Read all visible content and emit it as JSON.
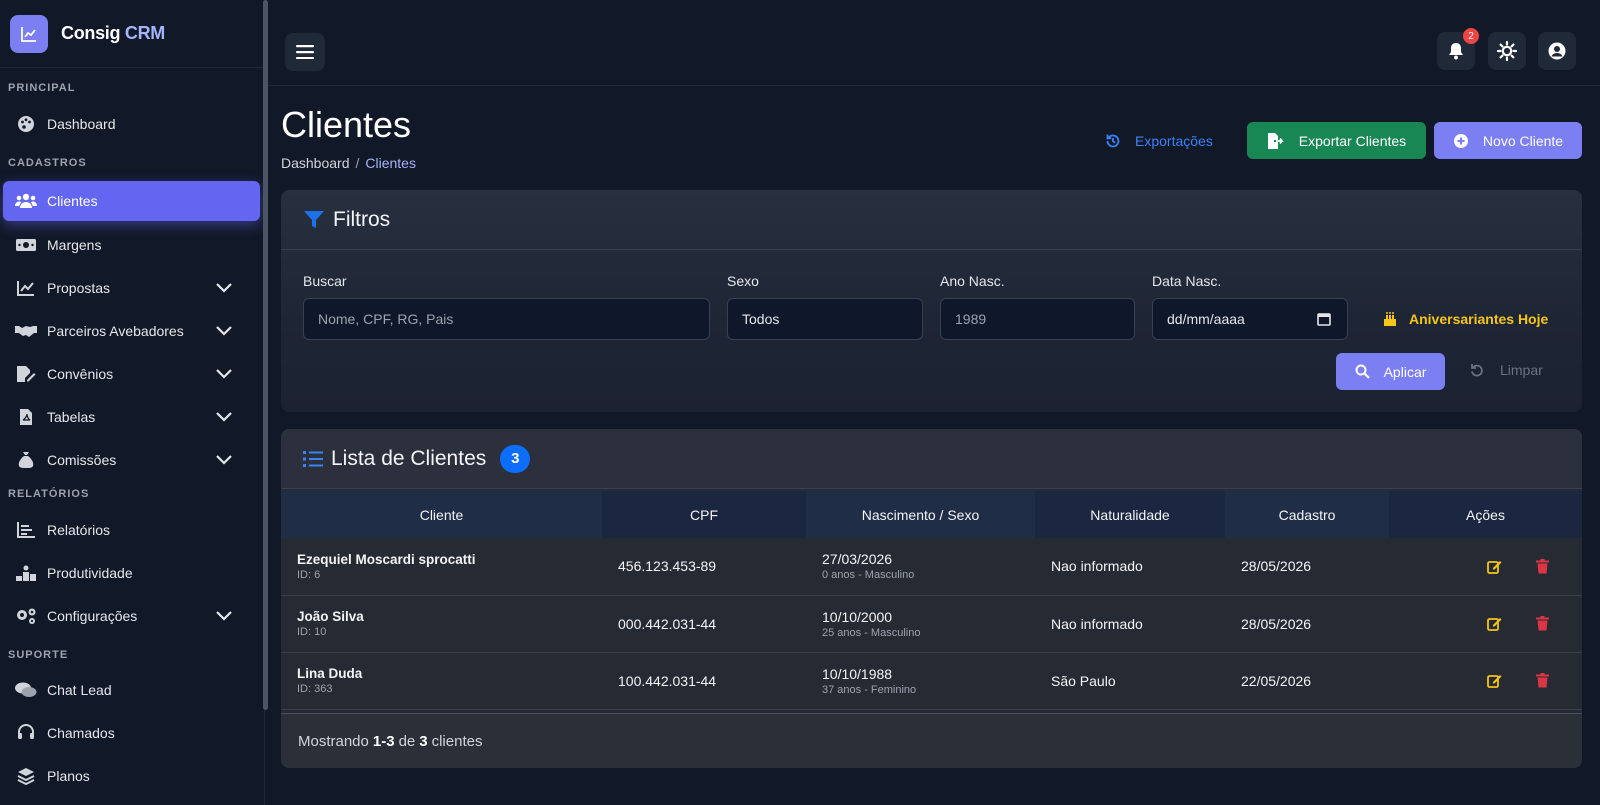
{
  "app": {
    "name_main": "Consig",
    "name_accent": "CRM"
  },
  "colors": {
    "accent": "#6366f1",
    "success": "#198754",
    "link": "#3b82f6",
    "warning": "#f5c518",
    "danger": "#dc3545"
  },
  "sidebar": {
    "sections": [
      {
        "title": "PRINCIPAL"
      },
      {
        "title": "CADASTROS"
      },
      {
        "title": "RELATÓRIOS"
      },
      {
        "title": "SUPORTE"
      }
    ],
    "items": [
      {
        "label": "Dashboard",
        "icon": "palette-icon"
      },
      {
        "label": "Clientes",
        "icon": "users-icon",
        "active": true
      },
      {
        "label": "Margens",
        "icon": "money-bill-icon"
      },
      {
        "label": "Propostas",
        "icon": "chart-line-icon"
      },
      {
        "label": "Parceiros Avebadores",
        "icon": "handshake-icon"
      },
      {
        "label": "Convênios",
        "icon": "file-signature-icon"
      },
      {
        "label": "Tabelas",
        "icon": "file-pdf-icon"
      },
      {
        "label": "Comissões",
        "icon": "money-bag-icon"
      },
      {
        "label": "Relatórios",
        "icon": "chart-bar-icon"
      },
      {
        "label": "Produtividade",
        "icon": "podium-icon"
      },
      {
        "label": "Configurações",
        "icon": "gears-icon"
      },
      {
        "label": "Chat Lead",
        "icon": "comments-icon"
      },
      {
        "label": "Chamados",
        "icon": "headset-icon"
      },
      {
        "label": "Planos",
        "icon": "layers-icon"
      }
    ]
  },
  "topbar": {
    "notifications_count": "2"
  },
  "page": {
    "title": "Clientes",
    "breadcrumb": {
      "home": "Dashboard",
      "separator": "/",
      "current": "Clientes"
    },
    "actions": {
      "exports": "Exportações",
      "export_clients": "Exportar Clientes",
      "new_client": "Novo Cliente"
    }
  },
  "filters": {
    "title": "Filtros",
    "search_label": "Buscar",
    "search_placeholder": "Nome, CPF, RG, Pais",
    "sex_label": "Sexo",
    "sex_value": "Todos",
    "year_label": "Ano Nasc.",
    "year_placeholder": "1989",
    "date_label": "Data Nasc.",
    "date_value": "dd/mm/aaaa",
    "birthdays": "Aniversariantes Hoje",
    "apply": "Aplicar",
    "clear": "Limpar"
  },
  "list": {
    "title": "Lista de Clientes",
    "count": "3",
    "columns": [
      "Cliente",
      "CPF",
      "Nascimento / Sexo",
      "Naturalidade",
      "Cadastro",
      "Ações"
    ],
    "rows": [
      {
        "name": "Ezequiel Moscardi sprocatti",
        "id": "ID: 6",
        "cpf": "456.123.453-89",
        "birth": "27/03/2026",
        "age_sex": "0 anos - Masculino",
        "origin": "Nao informado",
        "created": "28/05/2026"
      },
      {
        "name": "João Silva",
        "id": "ID: 10",
        "cpf": "000.442.031-44",
        "birth": "10/10/2000",
        "age_sex": "25 anos - Masculino",
        "origin": "Nao informado",
        "created": "28/05/2026"
      },
      {
        "name": "Lina Duda",
        "id": "ID: 363",
        "cpf": "100.442.031-44",
        "birth": "10/10/1988",
        "age_sex": "37 anos - Feminino",
        "origin": "São Paulo",
        "created": "22/05/2026"
      }
    ],
    "footer": {
      "prefix": "Mostrando",
      "range": "1-3",
      "middle": "de",
      "total": "3",
      "suffix": "clientes"
    }
  }
}
